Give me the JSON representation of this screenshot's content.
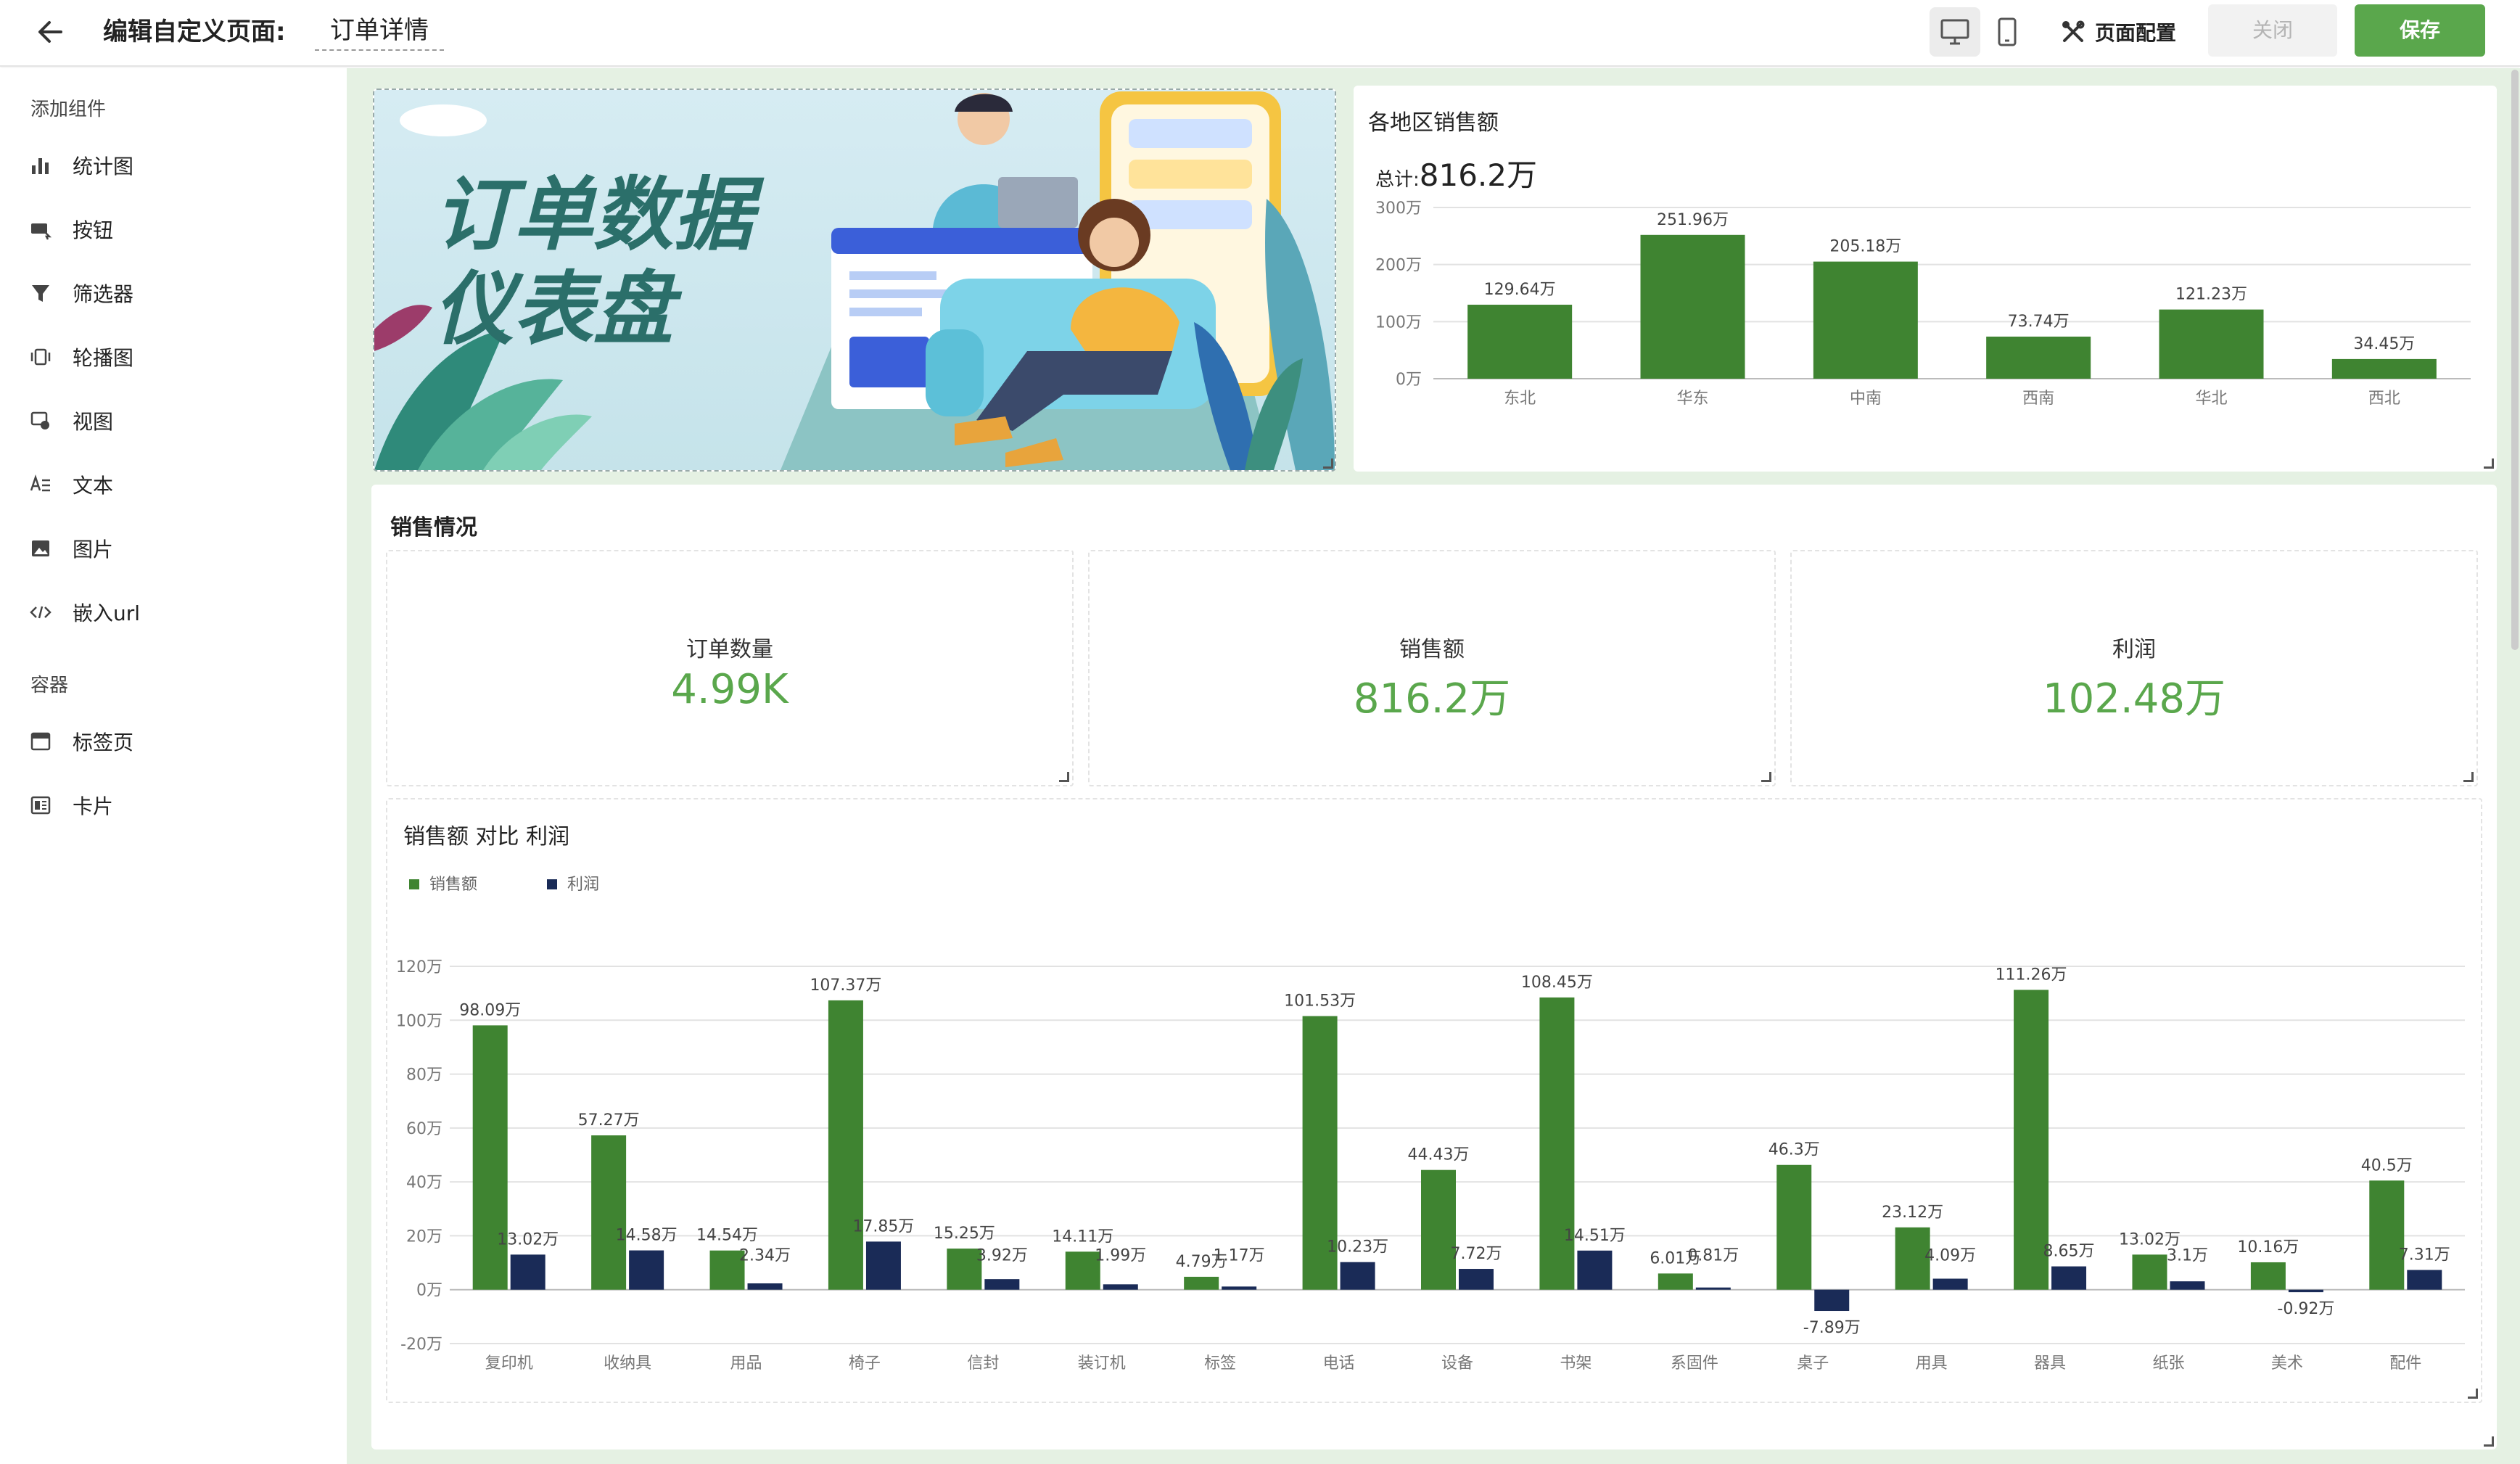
{
  "header": {
    "page_label": "编辑自定义页面:",
    "page_name": "订单详情",
    "config_label": "页面配置",
    "close_label": "关闭",
    "save_label": "保存",
    "accent_color": "#5aa74c"
  },
  "sidebar": {
    "group1_title": "添加组件",
    "items": [
      {
        "label": "统计图",
        "icon": "bar-chart-icon"
      },
      {
        "label": "按钮",
        "icon": "button-icon"
      },
      {
        "label": "筛选器",
        "icon": "filter-icon"
      },
      {
        "label": "轮播图",
        "icon": "carousel-icon"
      },
      {
        "label": "视图",
        "icon": "view-icon"
      },
      {
        "label": "文本",
        "icon": "text-icon"
      },
      {
        "label": "图片",
        "icon": "image-icon"
      },
      {
        "label": "嵌入url",
        "icon": "embed-code-icon"
      }
    ],
    "group2_title": "容器",
    "container_items": [
      {
        "label": "标签页",
        "icon": "tabs-icon"
      },
      {
        "label": "卡片",
        "icon": "card-icon"
      }
    ]
  },
  "banner": {
    "title_line1": "订单数据",
    "title_line2": "仪表盘"
  },
  "region_chart": {
    "title": "各地区销售额",
    "total_prefix": "总计:",
    "total_value": "816.2万",
    "chart_data": {
      "type": "bar",
      "categories": [
        "东北",
        "华东",
        "中南",
        "西南",
        "华北",
        "西北"
      ],
      "values": [
        129.64,
        251.96,
        205.18,
        73.74,
        121.23,
        34.45
      ],
      "value_labels": [
        "129.64万",
        "251.96万",
        "205.18万",
        "73.74万",
        "121.23万",
        "34.45万"
      ],
      "y_ticks": [
        "0万",
        "100万",
        "200万",
        "300万"
      ],
      "ylim": [
        0,
        300
      ],
      "color": "#3f8431",
      "grid": true
    }
  },
  "sales": {
    "title": "销售情况",
    "kpis": [
      {
        "label": "订单数量",
        "value": "4.99K"
      },
      {
        "label": "销售额",
        "value": "816.2万"
      },
      {
        "label": "利润",
        "value": "102.48万"
      }
    ]
  },
  "compare_chart": {
    "title": "销售额 对比 利润",
    "chart_data": {
      "type": "bar",
      "categories": [
        "复印机",
        "收纳具",
        "用品",
        "椅子",
        "信封",
        "装订机",
        "标签",
        "电话",
        "设备",
        "书架",
        "系固件",
        "桌子",
        "用具",
        "器具",
        "纸张",
        "美术",
        "配件"
      ],
      "series": [
        {
          "name": "销售额",
          "color": "#3f8431",
          "values": [
            98.09,
            57.27,
            14.54,
            107.37,
            15.25,
            14.11,
            4.79,
            101.53,
            44.43,
            108.45,
            6.01,
            46.3,
            23.12,
            111.26,
            13.02,
            10.16,
            40.5
          ],
          "labels": [
            "98.09万",
            "57.27万",
            "14.54万",
            "107.37万",
            "15.25万",
            "14.11万",
            "4.79万",
            "101.53万",
            "44.43万",
            "108.45万",
            "6.01万",
            "46.3万",
            "23.12万",
            "111.26万",
            "13.02万",
            "10.16万",
            "40.5万"
          ]
        },
        {
          "name": "利润",
          "color": "#1a2b57",
          "values": [
            13.02,
            14.58,
            2.34,
            17.85,
            3.92,
            1.99,
            1.17,
            10.23,
            7.72,
            14.51,
            0.81,
            -7.89,
            4.09,
            8.65,
            3.1,
            -0.92,
            7.31
          ],
          "labels": [
            "13.02万",
            "14.58万",
            "2.34万",
            "17.85万",
            "3.92万",
            "1.99万",
            "1.17万",
            "10.23万",
            "7.72万",
            "14.51万",
            "0.81万",
            "-7.89万",
            "4.09万",
            "8.65万",
            "3.1万",
            "-0.92万",
            "7.31万"
          ]
        }
      ],
      "y_ticks": [
        "-20万",
        "0万",
        "20万",
        "40万",
        "60万",
        "80万",
        "100万",
        "120万"
      ],
      "ylim": [
        -20,
        120
      ],
      "legend_position": "top-left",
      "grid": true
    }
  }
}
